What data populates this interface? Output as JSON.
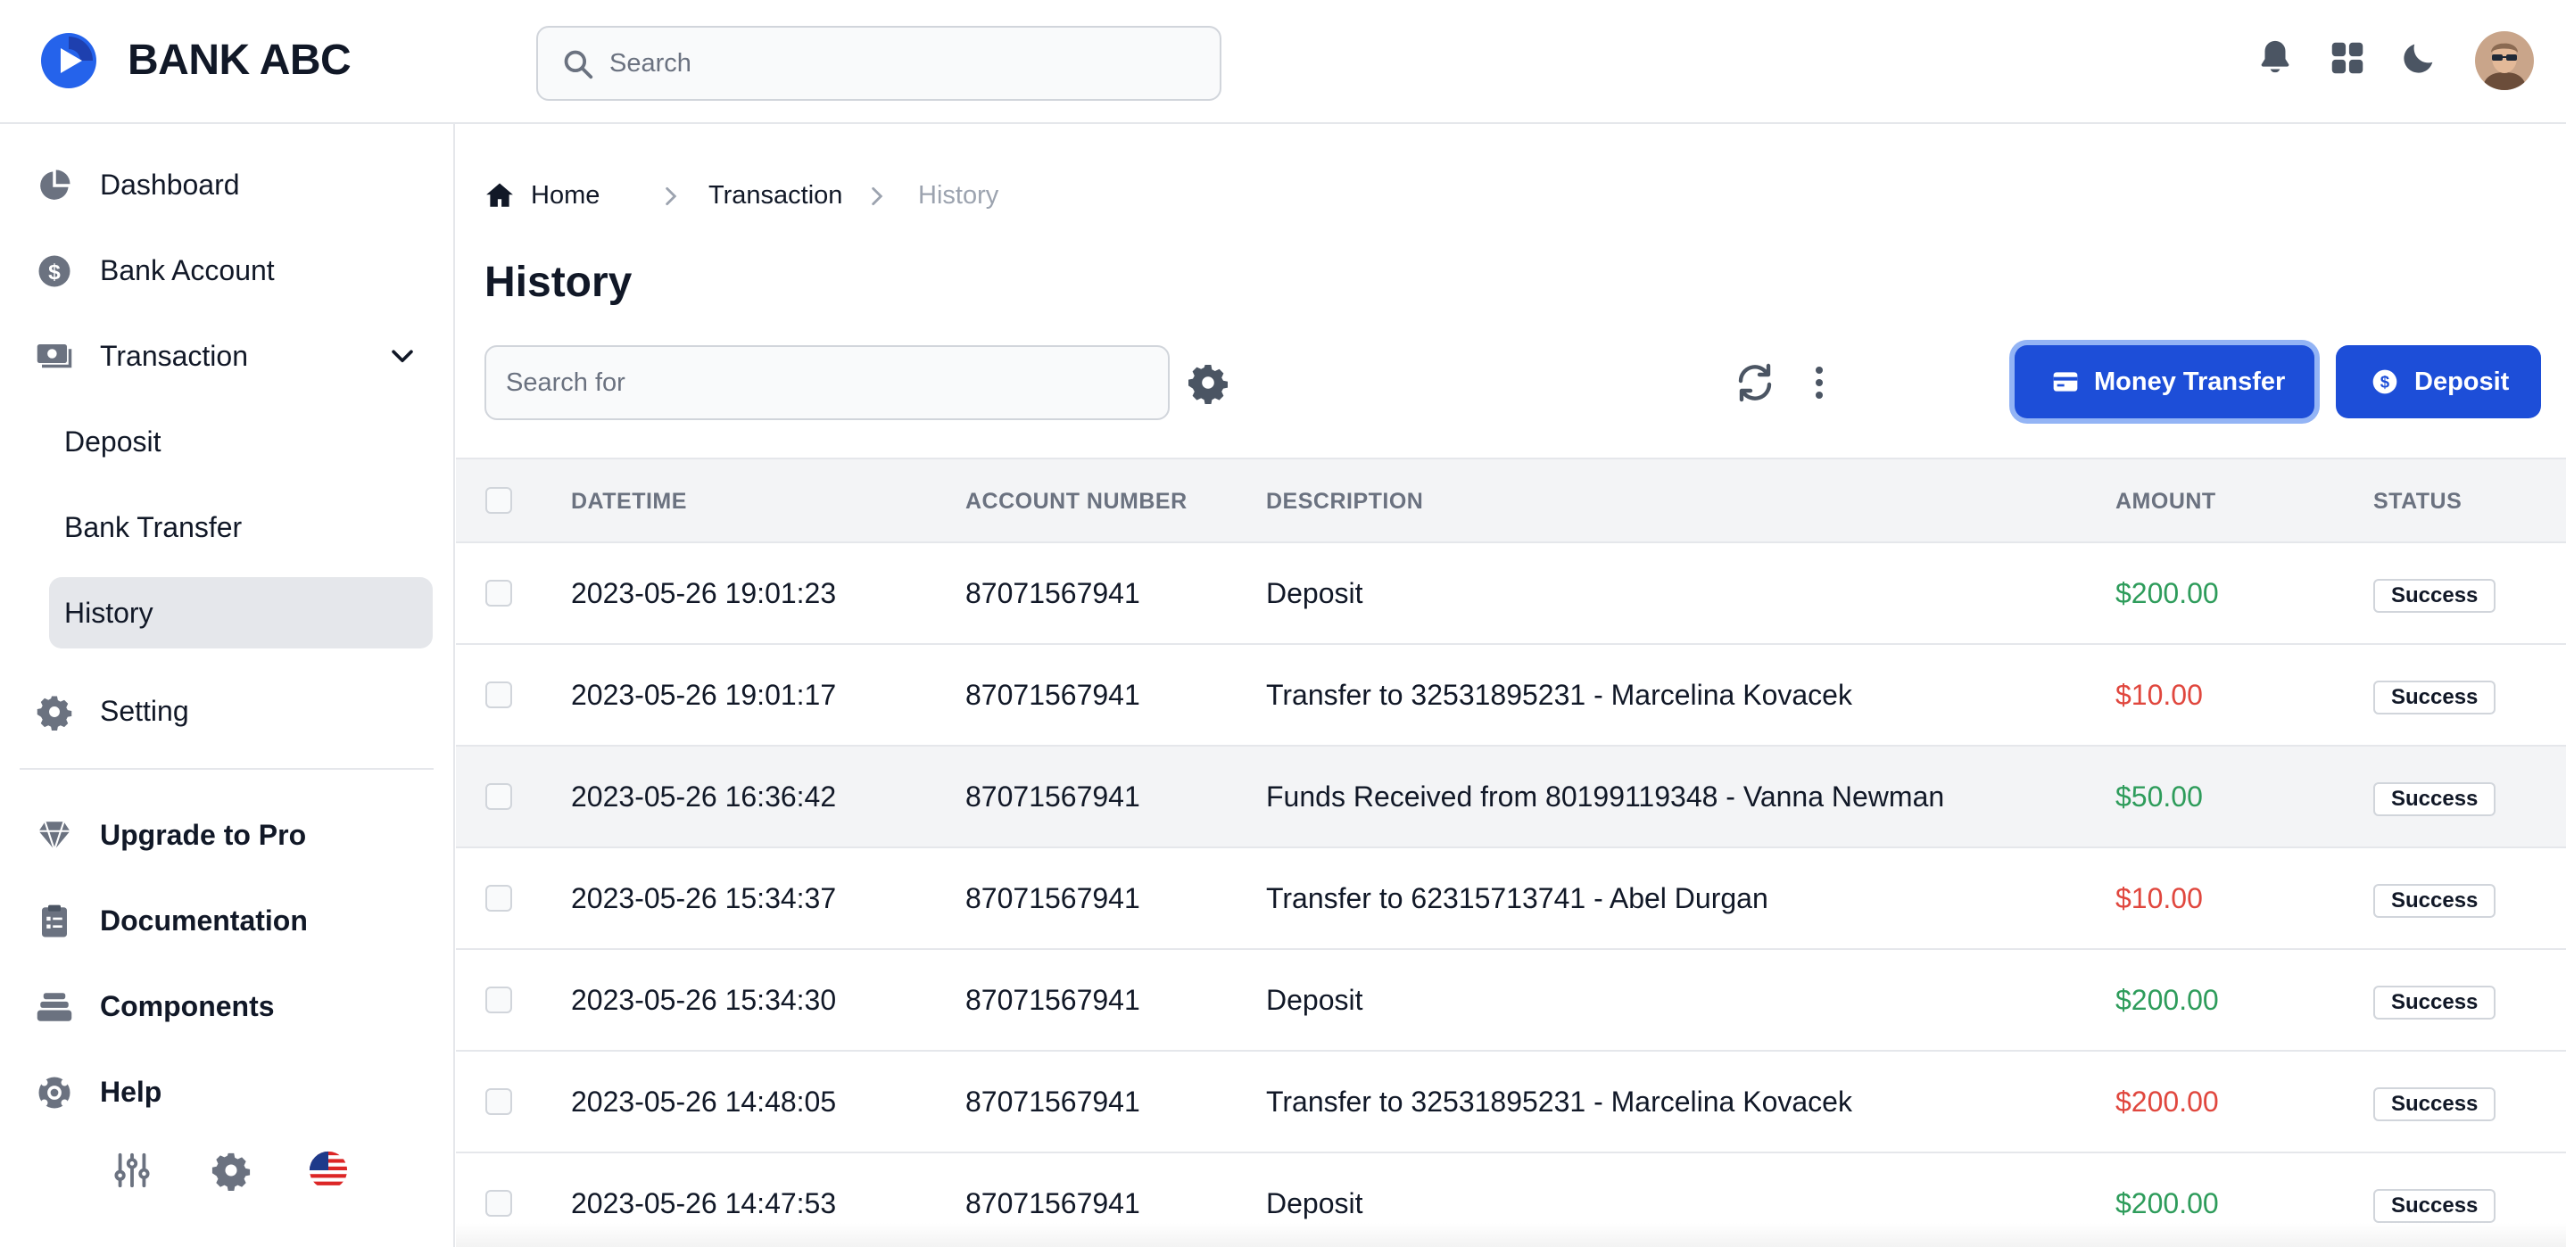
{
  "app": {
    "brand": "BANK ABC",
    "search_placeholder": "Search",
    "brand_color": "#1d4ed8"
  },
  "header_icons": [
    "bell-icon",
    "apps-grid-icon",
    "moon-icon",
    "user-avatar"
  ],
  "sidebar": {
    "items": [
      {
        "label": "Dashboard",
        "icon": "pie-chart-icon"
      },
      {
        "label": "Bank Account",
        "icon": "dollar-circle-icon"
      },
      {
        "label": "Transaction",
        "icon": "cash-icon",
        "expanded": true
      },
      {
        "label": "Deposit"
      },
      {
        "label": "Bank Transfer"
      },
      {
        "label": "History",
        "active": true
      },
      {
        "label": "Setting",
        "icon": "gear-icon"
      },
      {
        "label": "Upgrade to Pro",
        "icon": "gem-icon"
      },
      {
        "label": "Documentation",
        "icon": "clipboard-icon"
      },
      {
        "label": "Components",
        "icon": "stack-icon"
      },
      {
        "label": "Help",
        "icon": "lifebuoy-icon"
      }
    ],
    "bottom_icons": [
      "sliders-icon",
      "gear-icon",
      "us-flag-icon"
    ]
  },
  "breadcrumb": {
    "home": "Home",
    "section": "Transaction",
    "current": "History"
  },
  "page": {
    "title": "History",
    "search_placeholder": "Search for",
    "transfer_button": "Money Transfer",
    "deposit_button": "Deposit"
  },
  "table": {
    "columns": [
      "DATETIME",
      "ACCOUNT NUMBER",
      "DESCRIPTION",
      "AMOUNT",
      "STATUS"
    ],
    "rows": [
      {
        "datetime": "2023-05-26 19:01:23",
        "account": "87071567941",
        "description": "Deposit",
        "amount": "$200.00",
        "type": "credit",
        "status": "Success"
      },
      {
        "datetime": "2023-05-26 19:01:17",
        "account": "87071567941",
        "description": "Transfer to 32531895231 - Marcelina Kovacek",
        "amount": "$10.00",
        "type": "debit",
        "status": "Success"
      },
      {
        "datetime": "2023-05-26 16:36:42",
        "account": "87071567941",
        "description": "Funds Received from 80199119348 - Vanna Newman",
        "amount": "$50.00",
        "type": "credit",
        "status": "Success"
      },
      {
        "datetime": "2023-05-26 15:34:37",
        "account": "87071567941",
        "description": "Transfer to 62315713741 - Abel Durgan",
        "amount": "$10.00",
        "type": "debit",
        "status": "Success"
      },
      {
        "datetime": "2023-05-26 15:34:30",
        "account": "87071567941",
        "description": "Deposit",
        "amount": "$200.00",
        "type": "credit",
        "status": "Success"
      },
      {
        "datetime": "2023-05-26 14:48:05",
        "account": "87071567941",
        "description": "Transfer to 32531895231 - Marcelina Kovacek",
        "amount": "$200.00",
        "type": "debit",
        "status": "Success"
      },
      {
        "datetime": "2023-05-26 14:47:53",
        "account": "87071567941",
        "description": "Deposit",
        "amount": "$200.00",
        "type": "credit",
        "status": "Success"
      }
    ],
    "colors": {
      "credit": "#2e9c5b",
      "debit": "#e0473e"
    }
  }
}
